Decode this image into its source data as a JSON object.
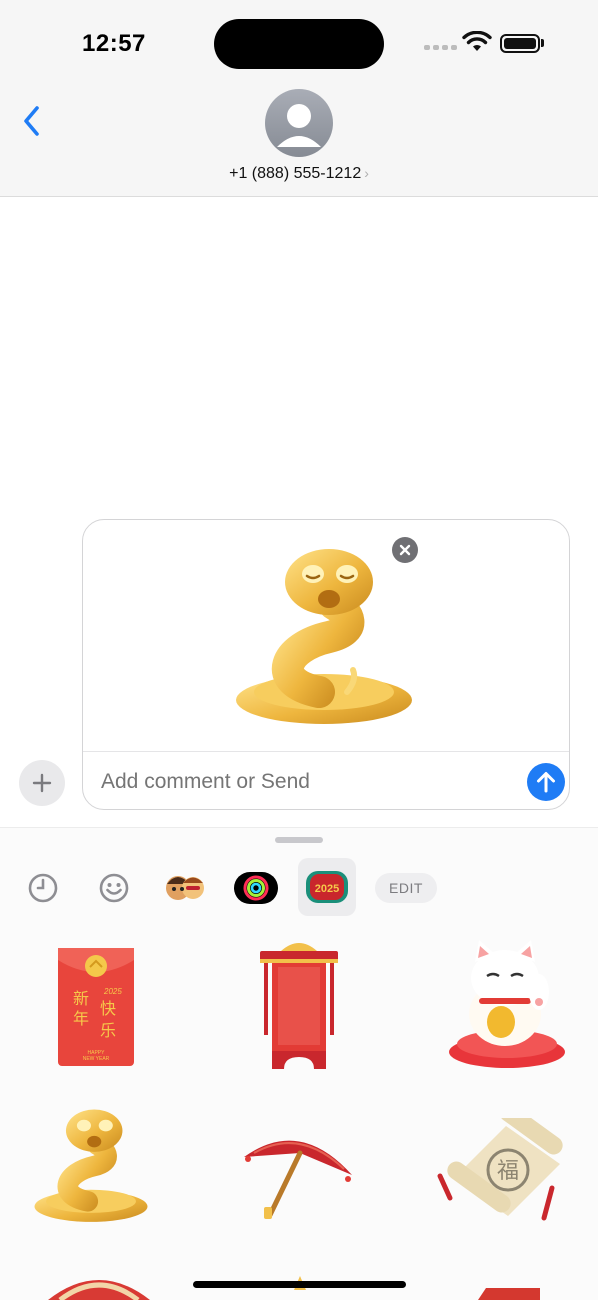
{
  "status_bar": {
    "time": "12:57"
  },
  "header": {
    "contact": "+1 (888) 555-1212",
    "contact_chevron": "›"
  },
  "compose": {
    "placeholder": "Add comment or Send"
  },
  "drawer": {
    "edit_label": "EDIT",
    "tabs": [
      "clock-icon",
      "smiley-icon",
      "memoji-icon",
      "activity-rings-icon",
      "sticker-pack-2025-icon"
    ],
    "red_envelope": {
      "chars": [
        "新",
        "快",
        "年",
        "乐"
      ],
      "year": "2025",
      "caption_line1": "HAPPY",
      "caption_line2": "NEW YEAR"
    },
    "tab_badge": "2025",
    "scroll_seal": "福"
  },
  "colors": {
    "accent": "#1f7cf5",
    "gold": "#e9b33a",
    "red": "#e23b35"
  }
}
